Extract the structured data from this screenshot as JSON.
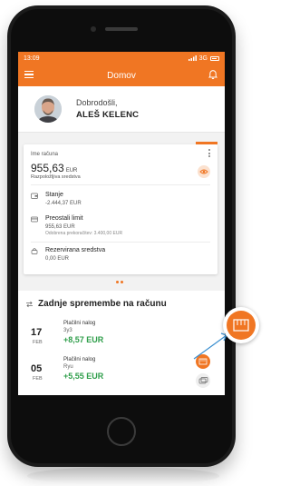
{
  "status_bar": {
    "time": "13:09",
    "network": "3G"
  },
  "header": {
    "title": "Domov"
  },
  "greeting": {
    "welcome": "Dobrodošli,",
    "name": "ALEŠ KELENC"
  },
  "account_card": {
    "account_label": "Ime računa",
    "balance": "955,63",
    "currency": "EUR",
    "available_label": "Razpoložljiva sredstva",
    "items": [
      {
        "title": "Stanje",
        "value": "-2.444,37 EUR",
        "note": ""
      },
      {
        "title": "Preostali limit",
        "value": "955,63 EUR",
        "note": "Odobrena prekoračitev: 3.400,00 EUR"
      },
      {
        "title": "Rezervirana sredstva",
        "value": "0,00 EUR",
        "note": ""
      }
    ]
  },
  "recent": {
    "title": "Zadnje spremembe na računu",
    "transactions": [
      {
        "day": "17",
        "month": "FEB",
        "type": "Plačilni nalog",
        "desc": "3y3",
        "amount": "+8,57 EUR"
      },
      {
        "day": "05",
        "month": "FEB",
        "type": "Plačilni nalog",
        "desc": "Ryu",
        "amount": "+5,55 EUR"
      }
    ]
  },
  "colors": {
    "accent": "#f07623",
    "positive": "#2e9e4a"
  },
  "icons": {
    "menu": "menu-icon",
    "bell": "bell-icon",
    "eye": "eye-icon",
    "balance": "wallet-icon",
    "limit": "credit-card-icon",
    "reserved": "lock-icon",
    "swap": "swap-icon",
    "payment_slip": "payment-slip-icon",
    "cards": "cards-icon"
  }
}
